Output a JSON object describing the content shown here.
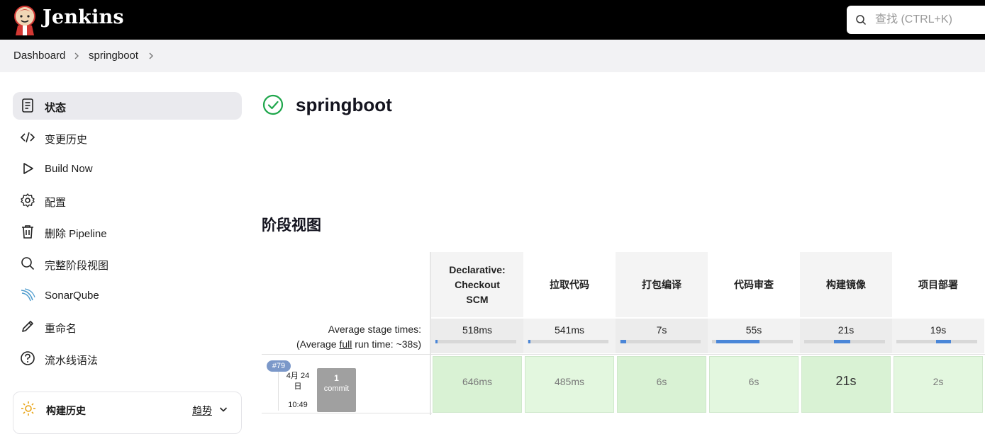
{
  "header": {
    "brand": "Jenkins",
    "search_placeholder": "查找 (CTRL+K)"
  },
  "breadcrumb": [
    {
      "label": "Dashboard"
    },
    {
      "label": "springboot"
    }
  ],
  "sidebar": {
    "items": [
      {
        "label": "状态",
        "icon": "status-icon",
        "active": true
      },
      {
        "label": "变更历史",
        "icon": "code-icon"
      },
      {
        "label": "Build Now",
        "icon": "play-icon"
      },
      {
        "label": "配置",
        "icon": "gear-icon"
      },
      {
        "label": "删除 Pipeline",
        "icon": "trash-icon"
      },
      {
        "label": "完整阶段视图",
        "icon": "search-icon"
      },
      {
        "label": "SonarQube",
        "icon": "sonarqube-icon"
      },
      {
        "label": "重命名",
        "icon": "pencil-icon"
      },
      {
        "label": "流水线语法",
        "icon": "help-icon"
      }
    ],
    "build_history": {
      "label": "构建历史",
      "trend_label": "趋势",
      "icon": "sun-icon"
    }
  },
  "main": {
    "title": "springboot",
    "status": "success",
    "stage_view_title": "阶段视图"
  },
  "stage_view": {
    "avg_label_line1": "Average stage times:",
    "avg_label_line2_prefix": "(Average ",
    "avg_label_line2_link": "full",
    "avg_label_line2_suffix": " run time: ~38s)",
    "stages": [
      {
        "name_lines": [
          "Declarative:",
          "Checkout",
          "SCM"
        ],
        "avg": "518ms",
        "avg_fraction": 0.01,
        "run": "646ms"
      },
      {
        "name_lines": [
          "拉取代码"
        ],
        "avg": "541ms",
        "avg_fraction": 0.01,
        "run": "485ms"
      },
      {
        "name_lines": [
          "打包编译"
        ],
        "avg": "7s",
        "avg_fraction": 0.07,
        "run": "6s"
      },
      {
        "name_lines": [
          "代码审查"
        ],
        "avg": "55s",
        "avg_fraction": 0.53,
        "run": "6s"
      },
      {
        "name_lines": [
          "构建镜像"
        ],
        "avg": "21s",
        "avg_fraction": 0.2,
        "run": "21s"
      },
      {
        "name_lines": [
          "项目部署"
        ],
        "avg": "19s",
        "avg_fraction": 0.18,
        "run": "2s"
      }
    ],
    "build": {
      "number": "#79",
      "date_line1": "4月 24",
      "date_line2": "日",
      "time": "10:49",
      "commit_count": "1",
      "commit_label": "commit"
    }
  },
  "colors": {
    "header_bg": "#000000",
    "success_green": "#1ea64b",
    "stage_success_bg": "#e3f7df",
    "progress_blue": "#4a86d8"
  }
}
